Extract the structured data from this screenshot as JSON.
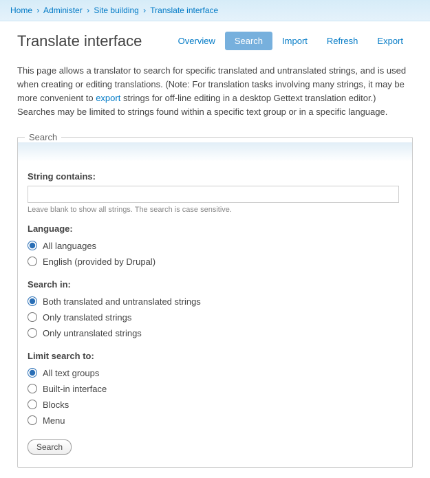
{
  "breadcrumb": {
    "items": [
      "Home",
      "Administer",
      "Site building",
      "Translate interface"
    ],
    "sep": "›"
  },
  "page_title": "Translate interface",
  "tabs": {
    "overview": "Overview",
    "search": "Search",
    "import": "Import",
    "refresh": "Refresh",
    "export": "Export"
  },
  "description": {
    "text_before": "This page allows a translator to search for specific translated and untranslated strings, and is used when creating or editing translations. (Note: For translation tasks involving many strings, it may be more convenient to ",
    "link_text": "export",
    "text_after": " strings for off-line editing in a desktop Gettext translation editor.) Searches may be limited to strings found within a specific text group or in a specific language."
  },
  "fieldset_legend": "Search",
  "fields": {
    "string_contains": {
      "label": "String contains:",
      "value": "",
      "hint": "Leave blank to show all strings. The search is case sensitive."
    },
    "language": {
      "label": "Language:",
      "options": {
        "all": "All languages",
        "en": "English (provided by Drupal)"
      }
    },
    "search_in": {
      "label": "Search in:",
      "options": {
        "both": "Both translated and untranslated strings",
        "translated": "Only translated strings",
        "untranslated": "Only untranslated strings"
      }
    },
    "limit": {
      "label": "Limit search to:",
      "options": {
        "all": "All text groups",
        "builtin": "Built-in interface",
        "blocks": "Blocks",
        "menu": "Menu"
      }
    }
  },
  "submit_label": "Search"
}
